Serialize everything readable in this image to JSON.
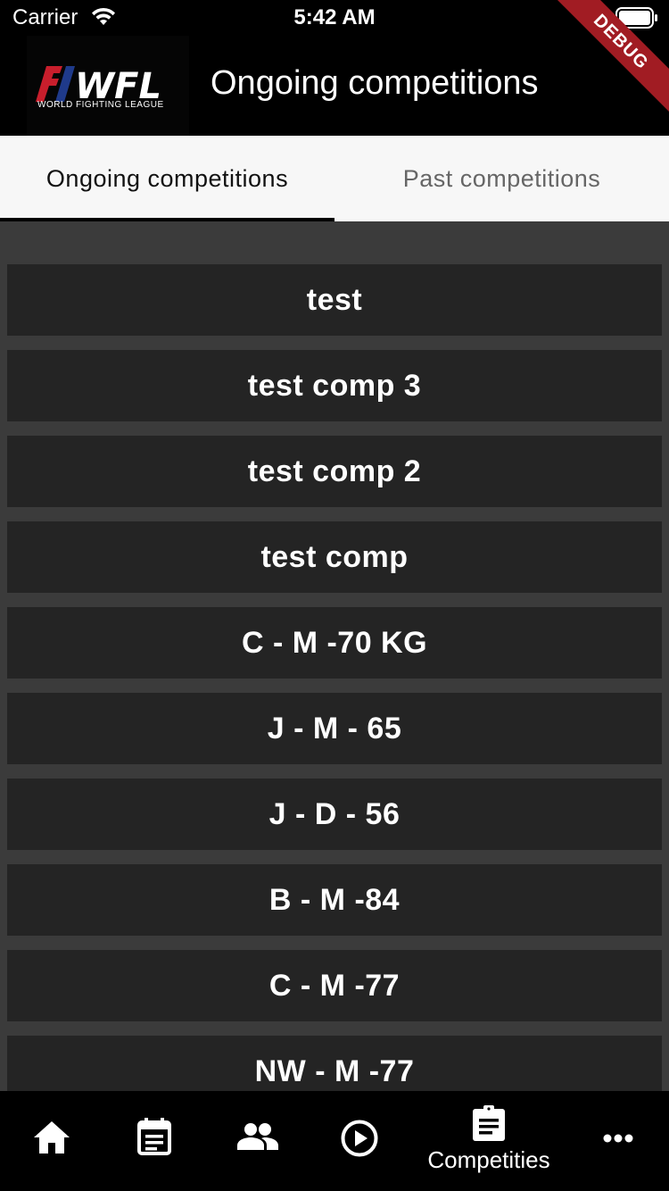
{
  "status_bar": {
    "carrier": "Carrier",
    "time": "5:42 AM"
  },
  "debug_banner": "DEBUG",
  "app_bar": {
    "logo_letters": "WFL",
    "logo_caption": "WORLD FIGHTING LEAGUE",
    "title": "Ongoing competitions"
  },
  "tabs": [
    {
      "label": "Ongoing competitions",
      "selected": true
    },
    {
      "label": "Past competitions",
      "selected": false
    }
  ],
  "competitions": [
    "test",
    "test comp 3",
    "test comp 2",
    "test comp",
    "C - M -70 KG",
    "J - M - 65",
    "J - D - 56",
    "B - M -84",
    "C - M -77",
    "NW - M -77"
  ],
  "bottom_nav": {
    "items": [
      {
        "icon": "home-icon"
      },
      {
        "icon": "calendar-icon"
      },
      {
        "icon": "people-icon"
      },
      {
        "icon": "play-circle-icon"
      },
      {
        "icon": "clipboard-icon",
        "label": "Competities",
        "selected": true
      },
      {
        "icon": "more-icon"
      }
    ]
  },
  "colors": {
    "accent_red": "#a11c23",
    "logo_blue": "#1f3a8a",
    "list_item_bg": "#242424",
    "list_bg": "#3b3b3b"
  }
}
